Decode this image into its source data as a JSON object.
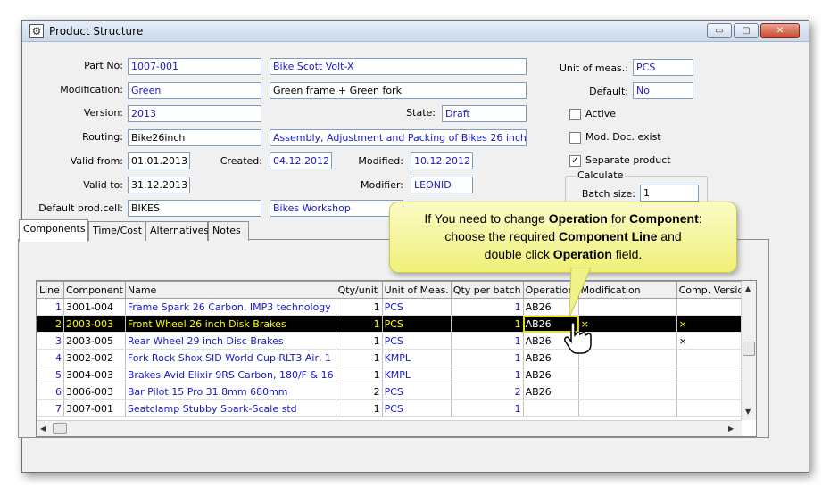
{
  "window": {
    "title": "Product Structure",
    "buttons": {
      "minimize": "▭",
      "maximize": "▢",
      "close": "✕"
    }
  },
  "form": {
    "part_no_label": "Part No:",
    "part_no": "1007-001",
    "part_name": "Bike Scott Volt-X",
    "modification_label": "Modification:",
    "modification": "Green",
    "modification_desc": "Green frame + Green fork",
    "version_label": "Version:",
    "version": "2013",
    "state_label": "State:",
    "state": "Draft",
    "routing_label": "Routing:",
    "routing": "Bike26inch",
    "routing_desc": "Assembly, Adjustment and Packing of Bikes 26 inch",
    "valid_from_label": "Valid from:",
    "valid_from": "01.01.2013",
    "created_label": "Created:",
    "created": "04.12.2012",
    "modified_label": "Modified:",
    "modified": "10.12.2012",
    "valid_to_label": "Valid to:",
    "valid_to": "31.12.2013",
    "modifier_label": "Modifier:",
    "modifier": "LEONID",
    "default_cell_label": "Default prod.cell:",
    "default_cell": "BIKES",
    "default_cell_desc": "Bikes Workshop",
    "unit_label": "Unit of meas.:",
    "unit": "PCS",
    "default_label": "Default:",
    "default": "No",
    "active_label": "Active",
    "mod_doc_label": "Mod. Doc. exist",
    "separate_label": "Separate product",
    "calculate_label": "Calculate",
    "batch_size_label": "Batch size:",
    "batch_size": "1"
  },
  "tabs": [
    "Components",
    "Time/Cost",
    "Alternatives",
    "Notes"
  ],
  "grid": {
    "columns": [
      "Line",
      "Component",
      "Name",
      "Qty/unit",
      "Unit of Meas.",
      "Qty per batch",
      "Operation",
      "Modification",
      "Comp. Version"
    ],
    "rows": [
      {
        "line": "1",
        "component": "3001-004",
        "name": "Frame Spark 26 Carbon, IMP3 technology",
        "qty": "1",
        "unit": "PCS",
        "batch": "1",
        "operation": "AB26",
        "mod": "",
        "ver": ""
      },
      {
        "line": "2",
        "component": "2003-003",
        "name": "Front Wheel 26 inch Disk Brakes",
        "qty": "1",
        "unit": "PCS",
        "batch": "1",
        "operation": "AB26",
        "mod": "×",
        "ver": "×"
      },
      {
        "line": "3",
        "component": "2003-005",
        "name": "Rear Wheel 29 inch Disc Brakes",
        "qty": "1",
        "unit": "PCS",
        "batch": "1",
        "operation": "AB26",
        "mod": "",
        "ver": "×"
      },
      {
        "line": "4",
        "component": "3002-002",
        "name": "Fork Rock Shox SID World Cup RLT3 Air, 1",
        "qty": "1",
        "unit": "KMPL",
        "batch": "1",
        "operation": "AB26",
        "mod": "",
        "ver": ""
      },
      {
        "line": "5",
        "component": "3004-003",
        "name": "Brakes Avid Elixir 9RS Carbon, 180/F & 16",
        "qty": "1",
        "unit": "KMPL",
        "batch": "1",
        "operation": "AB26",
        "mod": "",
        "ver": ""
      },
      {
        "line": "6",
        "component": "3006-003",
        "name": "Bar Pilot 15 Pro 31.8mm 680mm",
        "qty": "2",
        "unit": "PCS",
        "batch": "2",
        "operation": "AB26",
        "mod": "",
        "ver": ""
      },
      {
        "line": "7",
        "component": "3007-001",
        "name": "Seatclamp Stubby Spark-Scale std",
        "qty": "1",
        "unit": "PCS",
        "batch": "1",
        "operation": "",
        "mod": "",
        "ver": ""
      }
    ]
  },
  "callout": {
    "p1": "If You need to change ",
    "b1": "Operation",
    "p2": " for ",
    "b2": "Component",
    "p3": ":",
    "p4": "choose the required ",
    "b3": "Component Line",
    "p5": " and",
    "p6": "double click ",
    "b4": "Operation",
    "p7": " field."
  },
  "colors": {
    "accent_blue": "#1818c8",
    "selected_row": "#000000",
    "selected_text": "#ffff00",
    "callout": "#f4f49a"
  }
}
